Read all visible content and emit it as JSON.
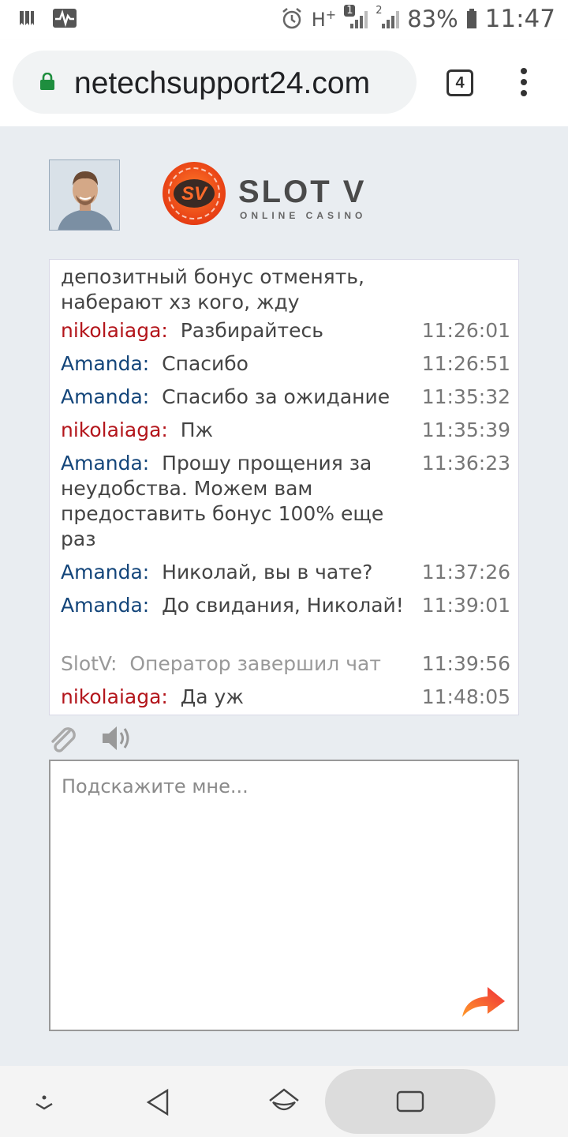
{
  "status_bar": {
    "network": "H",
    "network_sup": "+",
    "sim1": "1",
    "sim2": "2",
    "battery": "83%",
    "time": "11:47"
  },
  "browser": {
    "url": "netechsupport24.com",
    "tab_count": "4"
  },
  "brand": {
    "name": "SLOT V",
    "tagline": "ONLINE CASINO",
    "monogram": "SV",
    "accent": "#f2541b"
  },
  "chat": {
    "partial_top": "депозитный бонус отменять, наберают хз кого, жду",
    "messages": [
      {
        "sender": "nikolaiaga:",
        "text": "Разбирайтесь",
        "time": "11:26:01",
        "role": "user"
      },
      {
        "sender": "Amanda:",
        "text": "Спасибо",
        "time": "11:26:51",
        "role": "agent"
      },
      {
        "sender": "Amanda:",
        "text": "Спасибо за ожидание",
        "time": "11:35:32",
        "role": "agent"
      },
      {
        "sender": "nikolaiaga:",
        "text": "Пж",
        "time": "11:35:39",
        "role": "user"
      },
      {
        "sender": "Amanda:",
        "text": "Прошу прощения за неудобства. Можем вам предоставить бонус 100% еще раз",
        "time": "11:36:23",
        "role": "agent"
      },
      {
        "sender": "Amanda:",
        "text": "Николай, вы в чате?",
        "time": "11:37:26",
        "role": "agent"
      },
      {
        "sender": "Amanda:",
        "text": "До свидания, Николай!",
        "time": "11:39:01",
        "role": "agent"
      },
      {
        "sender": "SlotV:",
        "text": "Оператор завершил чат",
        "time": "11:39:56",
        "role": "system"
      },
      {
        "sender": "nikolaiaga:",
        "text": "Да уж",
        "time": "11:48:05",
        "role": "user"
      }
    ]
  },
  "reply": {
    "placeholder": "Подскажите мне...",
    "value": ""
  },
  "icons": {
    "attach": "paperclip-icon",
    "sound": "speaker-icon",
    "send": "send-arrow-icon",
    "lock": "lock-icon"
  },
  "colors": {
    "user_name": "#b3151b",
    "agent_name": "#13457a",
    "system_name": "#999999",
    "secure_lock": "#1e8e3e"
  }
}
